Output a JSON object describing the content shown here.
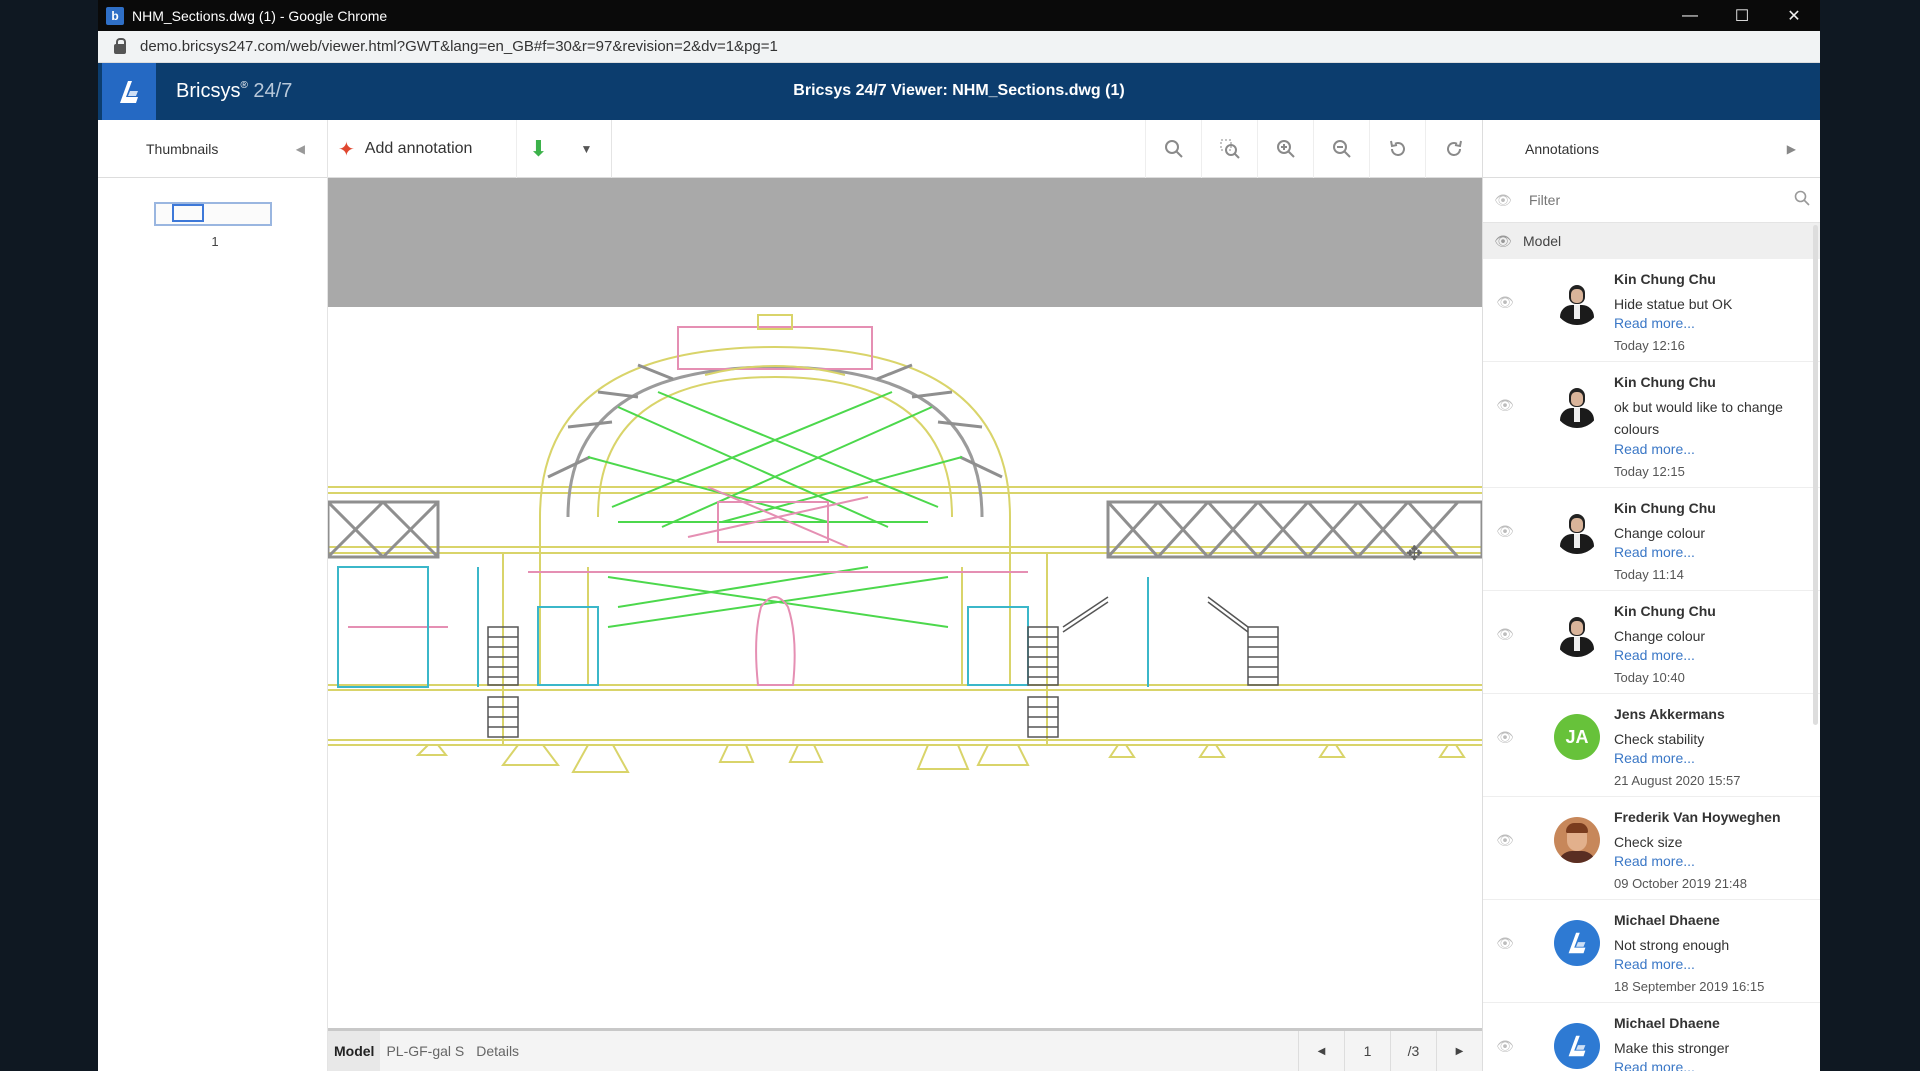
{
  "browser": {
    "window_title": "NHM_Sections.dwg (1) - Google Chrome",
    "url": "demo.bricsys247.com/web/viewer.html?GWT&lang=en_GB#f=30&r=97&revision=2&dv=1&pg=1",
    "controls": {
      "minimize": "—",
      "maximize": "☐",
      "close": "✕"
    }
  },
  "header": {
    "brand": "Bricsys",
    "brand_mark": "®",
    "brand_version": "24/7",
    "viewer_title": "Bricsys 24/7 Viewer: NHM_Sections.dwg (1)"
  },
  "toolbar": {
    "thumbnails_label": "Thumbnails",
    "add_annotation_label": "Add annotation",
    "annotations_label": "Annotations",
    "icons": [
      "zoom-icon",
      "zoom-window-icon",
      "zoom-in-icon",
      "zoom-out-icon",
      "rotate-left-icon",
      "rotate-right-icon"
    ]
  },
  "thumbnails": {
    "page_number": "1"
  },
  "bottom": {
    "tabs": [
      "Model",
      "PL-GF-gal S",
      "Details"
    ],
    "active_tab": "Model",
    "page": "1",
    "page_total": "/3"
  },
  "annotations": {
    "filter_placeholder": "Filter",
    "group_label": "Model",
    "read_more": "Read more...",
    "items": [
      {
        "author": "Kin Chung Chu",
        "message": "Hide statue but OK",
        "read_more": "Read more...",
        "time": "Today 12:16"
      },
      {
        "author": "Kin Chung Chu",
        "message": "ok but would like to change colours",
        "read_more": "Read more...",
        "time": "Today 12:15"
      },
      {
        "author": "Kin Chung Chu",
        "message": "Change colour",
        "read_more": "Read more...",
        "time": "Today 11:14"
      },
      {
        "author": "Kin Chung Chu",
        "message": "Change colour",
        "read_more": "Read more...",
        "time": "Today 10:40"
      },
      {
        "author": "Jens Akkermans",
        "initials": "JA",
        "message": "Check stability",
        "read_more": "Read more...",
        "time": "21 August 2020 15:57"
      },
      {
        "author": "Frederik Van Hoyweghen",
        "message": "Check size",
        "read_more": "Read more...",
        "time": "09 October 2019 21:48"
      },
      {
        "author": "Michael Dhaene",
        "message": "Not strong enough",
        "read_more": "Read more...",
        "time": "18 September 2019 16:15"
      },
      {
        "author": "Michael Dhaene",
        "message": "Make this stronger",
        "read_more": "Read more...",
        "time": ""
      }
    ]
  },
  "colors": {
    "header_bg": "#0c3d6e",
    "logo_bg": "#2569c3",
    "link": "#3a77c6",
    "download": "#3cb24a",
    "pin": "#e0472f",
    "drawing_yellow": "#d9d46a",
    "drawing_green": "#4cd84c",
    "drawing_pink": "#e58fb3",
    "drawing_cyan": "#3bb7c9"
  }
}
